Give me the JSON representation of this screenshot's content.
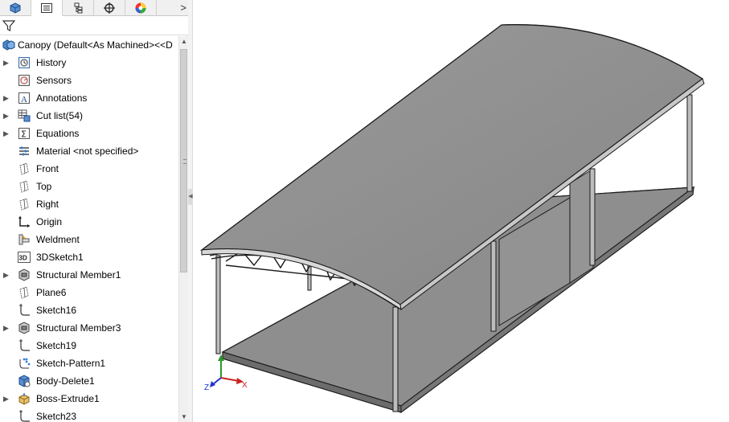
{
  "panel_tabs": [
    {
      "name": "feature-manager-tab",
      "icon": "feature-tree-icon"
    },
    {
      "name": "property-manager-tab",
      "icon": "property-list-icon"
    },
    {
      "name": "configuration-manager-tab",
      "icon": "configuration-icon"
    },
    {
      "name": "dimxpert-manager-tab",
      "icon": "crosshair-icon"
    },
    {
      "name": "display-manager-tab",
      "icon": "color-wheel-icon"
    }
  ],
  "tabs_more": ">",
  "root": {
    "label": "Canopy  (Default<As Machined><<D",
    "icon": "part-icon"
  },
  "tree_items": [
    {
      "label": "History",
      "icon": "history-icon",
      "expandable": true
    },
    {
      "label": "Sensors",
      "icon": "sensors-icon",
      "expandable": false
    },
    {
      "label": "Annotations",
      "icon": "annotations-icon",
      "expandable": true
    },
    {
      "label": "Cut list(54)",
      "icon": "cut-list-icon",
      "expandable": true
    },
    {
      "label": "Equations",
      "icon": "equations-icon",
      "expandable": true
    },
    {
      "label": "Material <not specified>",
      "icon": "material-icon",
      "expandable": false
    },
    {
      "label": "Front",
      "icon": "plane-icon",
      "expandable": false
    },
    {
      "label": "Top",
      "icon": "plane-icon",
      "expandable": false
    },
    {
      "label": "Right",
      "icon": "plane-icon",
      "expandable": false
    },
    {
      "label": "Origin",
      "icon": "origin-icon",
      "expandable": false
    },
    {
      "label": "Weldment",
      "icon": "weldment-icon",
      "expandable": false
    },
    {
      "label": "3DSketch1",
      "icon": "3d-sketch-icon",
      "expandable": false
    },
    {
      "label": "Structural Member1",
      "icon": "structural-member-icon",
      "expandable": true
    },
    {
      "label": "Plane6",
      "icon": "plane-icon",
      "expandable": false
    },
    {
      "label": "Sketch16",
      "icon": "sketch-icon",
      "expandable": false
    },
    {
      "label": "Structural Member3",
      "icon": "structural-member-icon",
      "expandable": true
    },
    {
      "label": "Sketch19",
      "icon": "sketch-icon",
      "expandable": false
    },
    {
      "label": "Sketch-Pattern1",
      "icon": "sketch-pattern-icon",
      "expandable": false
    },
    {
      "label": "Body-Delete1",
      "icon": "body-delete-icon",
      "expandable": false
    },
    {
      "label": "Boss-Extrude1",
      "icon": "extrude-icon",
      "expandable": true
    },
    {
      "label": "Sketch23",
      "icon": "sketch-icon",
      "expandable": false
    }
  ],
  "icon_3d_text": "3D",
  "icon_sigma": "Σ",
  "icon_a": "A",
  "triad": {
    "x_label": "X",
    "z_label": "Z"
  },
  "colors": {
    "model_gray": "#8e8e8e",
    "model_dark": "#6e6e6e",
    "edge": "#1a1a1a",
    "accent_blue": "#1a5fb4"
  }
}
